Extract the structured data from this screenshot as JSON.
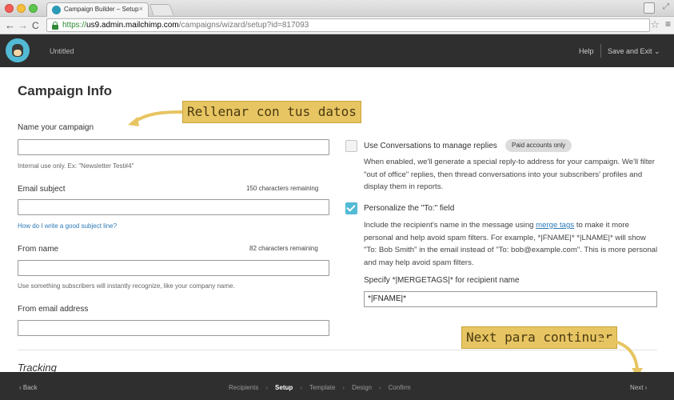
{
  "browser": {
    "tab_title": "Campaign Builder – Setup",
    "tab_close": "×",
    "url_scheme": "https://",
    "url_host": "us9.admin.mailchimp.com",
    "url_path": "/campaigns/wizard/setup?id=817093",
    "nav_back": "←",
    "nav_forward": "→",
    "nav_reload": "C",
    "star": "☆",
    "menu": "≡",
    "expand": "⤢"
  },
  "header": {
    "campaign_title": "Untitled",
    "help": "Help",
    "save_exit": "Save and Exit ⌄"
  },
  "page_title": "Campaign Info",
  "left": {
    "name_label": "Name your campaign",
    "name_value": "",
    "name_hint": "Internal use only. Ex: \"Newsletter Test#4\"",
    "subject_label": "Email subject",
    "subject_counter": "150 characters remaining",
    "subject_value": "",
    "subject_link": "How do I write a good subject line?",
    "from_name_label": "From name",
    "from_name_counter": "82 characters remaining",
    "from_name_value": "",
    "from_name_hint": "Use something subscribers will instantly recognize, like your company name.",
    "from_email_label": "From email address",
    "from_email_value": ""
  },
  "right": {
    "conversations_title": "Use Conversations to manage replies",
    "conversations_checked": false,
    "conversations_badge": "Paid accounts only",
    "conversations_desc": "When enabled, we'll generate a special reply-to address for your campaign. We'll filter \"out of office\" replies, then thread conversations into your subscribers' profiles and display them in reports.",
    "personalize_title": "Personalize the \"To:\" field",
    "personalize_checked": true,
    "personalize_desc_before": "Include the recipient's name in the message using ",
    "personalize_link": "merge tags",
    "personalize_desc_after": " to make it more personal and help avoid spam filters. For example, *|FNAME|* *|LNAME|* will show \"To: Bob Smith\" in the email instead of \"To: bob@example.com\". This is more personal and may help avoid spam filters.",
    "merge_label": "Specify *|MERGETAGS|* for recipient name",
    "merge_value": "*|FNAME|*"
  },
  "section_heading": "Tracking",
  "annotations": {
    "first": "Rellenar con tus datos",
    "second": "Next para continuar"
  },
  "footer": {
    "back": "‹ Back",
    "steps": [
      "Recipients",
      "Setup",
      "Template",
      "Design",
      "Confirm"
    ],
    "active_step": "Setup",
    "step_separator": "›",
    "next": "Next ›"
  },
  "colors": {
    "accent": "#52bad5",
    "link": "#2c7ab7",
    "dark_bar": "#2f2f2f",
    "annotation": "#e7c563"
  }
}
